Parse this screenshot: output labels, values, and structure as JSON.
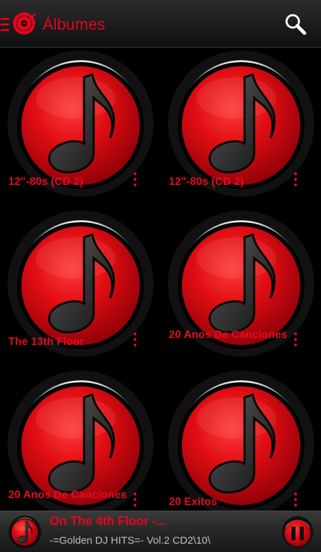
{
  "header": {
    "title": "Álbumes",
    "icons": {
      "menu": "hamburger-menu-icon",
      "logo": "vinyl-disc-icon",
      "search": "search-icon"
    }
  },
  "albums": [
    {
      "title": "12\"-80s (CD 2)"
    },
    {
      "title": "12\"-80s (CD 2)"
    },
    {
      "title": "The 13th Floor"
    },
    {
      "title": "20 Anos De Canciones"
    },
    {
      "title": "20 Anos De Canciones"
    },
    {
      "title": "20 Exitos"
    }
  ],
  "now_playing": {
    "title": "On The 4th Floor -...",
    "subtitle": "-=Golden DJ HITS=- Vol.2 CD2\\10\\"
  },
  "colors": {
    "accent": "#e3061e",
    "background": "#000000",
    "bar": "#262626"
  }
}
